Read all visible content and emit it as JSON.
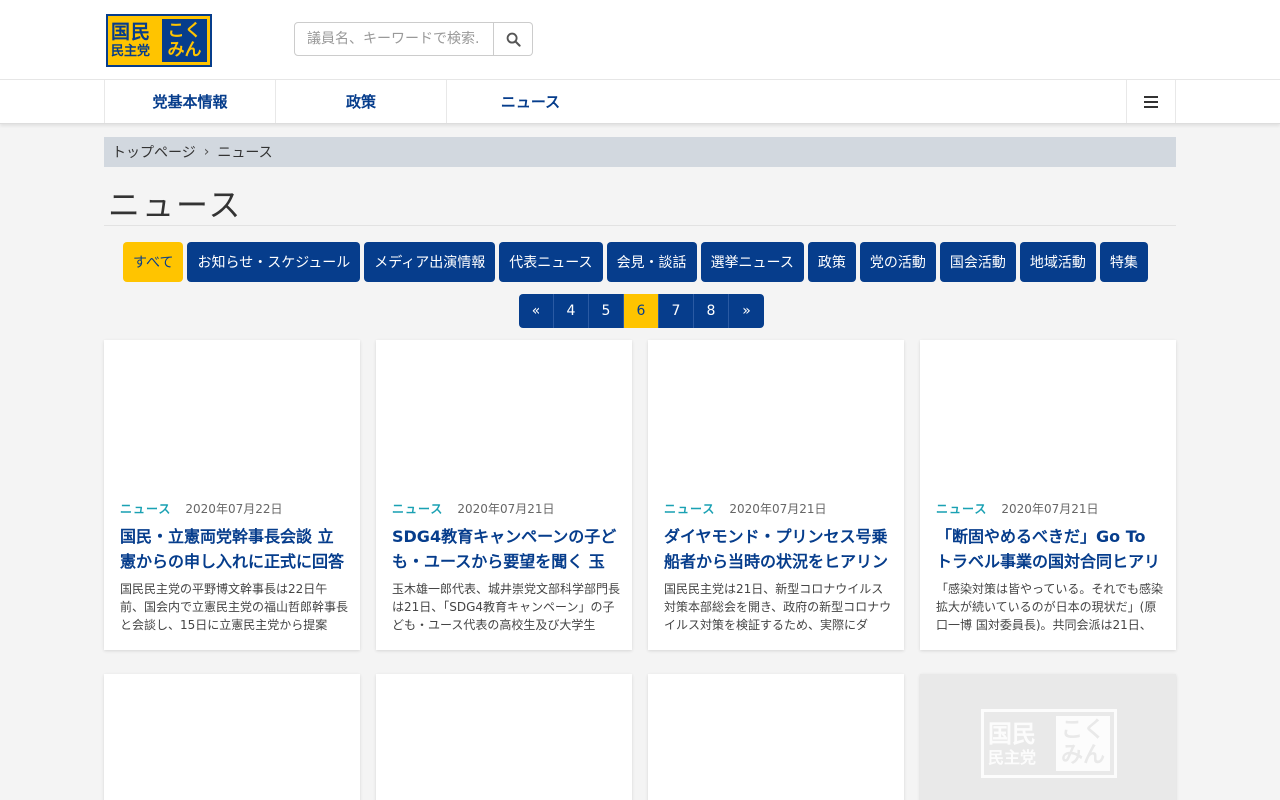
{
  "header": {
    "logo": {
      "line1": "国民",
      "line2": "民主党",
      "kana1": "こく",
      "kana2": "みん"
    },
    "search": {
      "placeholder": "議員名、キーワードで検索..."
    }
  },
  "nav": {
    "items": [
      {
        "label": "党基本情報"
      },
      {
        "label": "政策"
      },
      {
        "label": "ニュース"
      }
    ]
  },
  "breadcrumb": {
    "home": "トップページ",
    "separator": "›",
    "current": "ニュース"
  },
  "page_title": "ニュース",
  "categories": [
    {
      "label": "すべて",
      "active": true
    },
    {
      "label": "お知らせ・スケジュール"
    },
    {
      "label": "メディア出演情報"
    },
    {
      "label": "代表ニュース"
    },
    {
      "label": "会見・談話"
    },
    {
      "label": "選挙ニュース"
    },
    {
      "label": "政策"
    },
    {
      "label": "党の活動"
    },
    {
      "label": "国会活動"
    },
    {
      "label": "地域活動"
    },
    {
      "label": "特集"
    }
  ],
  "pagination": {
    "prev": "«",
    "pages": [
      "4",
      "5",
      "6",
      "7",
      "8"
    ],
    "current": "6",
    "next": "»"
  },
  "articles": [
    {
      "category": "ニュース",
      "date": "2020年07月22日",
      "title": "国民・立憲両党幹事長会談 立憲からの申し入れに正式に回答",
      "excerpt": "国民民主党の平野博文幹事長は22日午前、国会内で立憲民主党の福山哲郎幹事長と会談し、15日に立憲民主党から提案"
    },
    {
      "category": "ニュース",
      "date": "2020年07月21日",
      "title": "SDG4教育キャンペーンの子ども・ユースから要望を聞く 玉",
      "excerpt": "玉木雄一郎代表、城井崇党文部科学部門長は21日、「SDG4教育キャンペーン」の子ども・ユース代表の高校生及び大学生"
    },
    {
      "category": "ニュース",
      "date": "2020年07月21日",
      "title": "ダイヤモンド・プリンセス号乗船者から当時の状況をヒアリン",
      "excerpt": "国民民主党は21日、新型コロナウイルス対策本部総会を開き、政府の新型コロナウイルス対策を検証するため、実際にダ"
    },
    {
      "category": "ニュース",
      "date": "2020年07月21日",
      "title": "「断固やめるべきだ」Go To トラベル事業の国対合同ヒアリ",
      "excerpt": "「感染対策は皆やっている。それでも感染拡大が続いているのが日本の現状だ」(原口一博 国対委員長)。共同会派は21日、"
    }
  ],
  "colors": {
    "brand_navy": "#063d8c",
    "brand_yellow": "#ffc400",
    "category_teal": "#1aa1b3"
  }
}
